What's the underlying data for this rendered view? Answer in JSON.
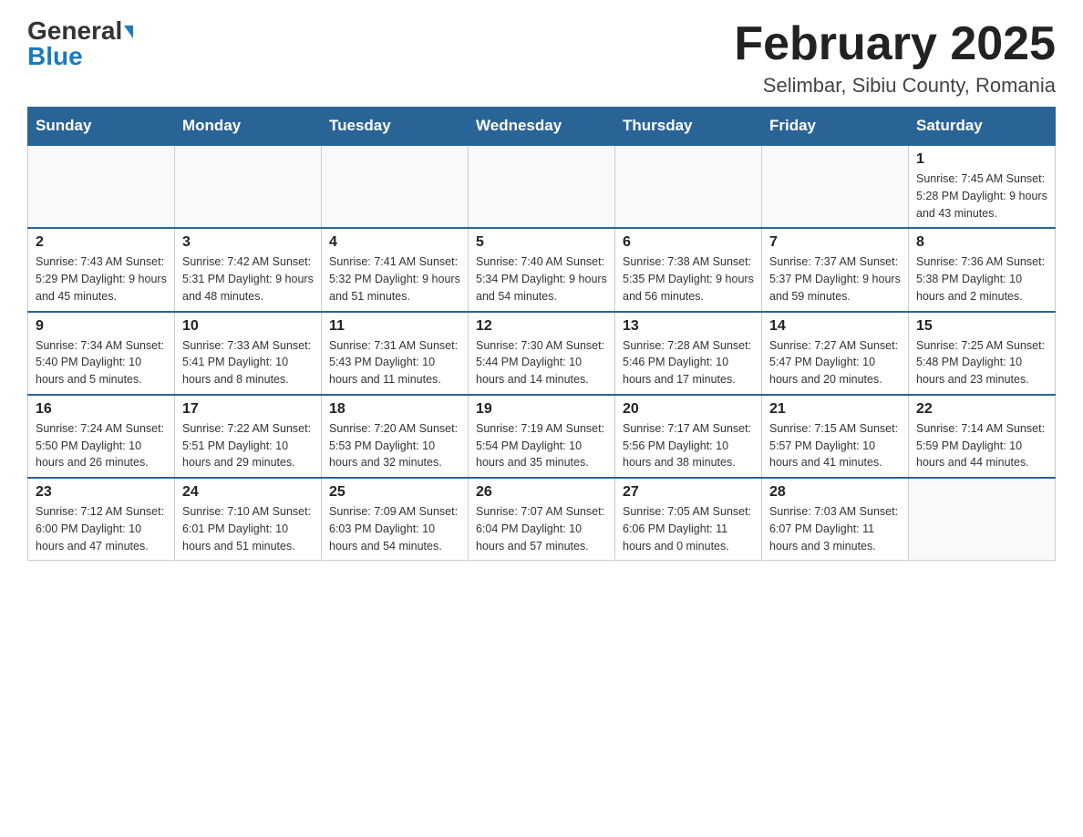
{
  "header": {
    "logo_general": "General",
    "logo_blue": "Blue",
    "month_title": "February 2025",
    "location": "Selimbar, Sibiu County, Romania"
  },
  "days_of_week": [
    "Sunday",
    "Monday",
    "Tuesday",
    "Wednesday",
    "Thursday",
    "Friday",
    "Saturday"
  ],
  "weeks": [
    [
      {
        "day": "",
        "info": ""
      },
      {
        "day": "",
        "info": ""
      },
      {
        "day": "",
        "info": ""
      },
      {
        "day": "",
        "info": ""
      },
      {
        "day": "",
        "info": ""
      },
      {
        "day": "",
        "info": ""
      },
      {
        "day": "1",
        "info": "Sunrise: 7:45 AM\nSunset: 5:28 PM\nDaylight: 9 hours and 43 minutes."
      }
    ],
    [
      {
        "day": "2",
        "info": "Sunrise: 7:43 AM\nSunset: 5:29 PM\nDaylight: 9 hours and 45 minutes."
      },
      {
        "day": "3",
        "info": "Sunrise: 7:42 AM\nSunset: 5:31 PM\nDaylight: 9 hours and 48 minutes."
      },
      {
        "day": "4",
        "info": "Sunrise: 7:41 AM\nSunset: 5:32 PM\nDaylight: 9 hours and 51 minutes."
      },
      {
        "day": "5",
        "info": "Sunrise: 7:40 AM\nSunset: 5:34 PM\nDaylight: 9 hours and 54 minutes."
      },
      {
        "day": "6",
        "info": "Sunrise: 7:38 AM\nSunset: 5:35 PM\nDaylight: 9 hours and 56 minutes."
      },
      {
        "day": "7",
        "info": "Sunrise: 7:37 AM\nSunset: 5:37 PM\nDaylight: 9 hours and 59 minutes."
      },
      {
        "day": "8",
        "info": "Sunrise: 7:36 AM\nSunset: 5:38 PM\nDaylight: 10 hours and 2 minutes."
      }
    ],
    [
      {
        "day": "9",
        "info": "Sunrise: 7:34 AM\nSunset: 5:40 PM\nDaylight: 10 hours and 5 minutes."
      },
      {
        "day": "10",
        "info": "Sunrise: 7:33 AM\nSunset: 5:41 PM\nDaylight: 10 hours and 8 minutes."
      },
      {
        "day": "11",
        "info": "Sunrise: 7:31 AM\nSunset: 5:43 PM\nDaylight: 10 hours and 11 minutes."
      },
      {
        "day": "12",
        "info": "Sunrise: 7:30 AM\nSunset: 5:44 PM\nDaylight: 10 hours and 14 minutes."
      },
      {
        "day": "13",
        "info": "Sunrise: 7:28 AM\nSunset: 5:46 PM\nDaylight: 10 hours and 17 minutes."
      },
      {
        "day": "14",
        "info": "Sunrise: 7:27 AM\nSunset: 5:47 PM\nDaylight: 10 hours and 20 minutes."
      },
      {
        "day": "15",
        "info": "Sunrise: 7:25 AM\nSunset: 5:48 PM\nDaylight: 10 hours and 23 minutes."
      }
    ],
    [
      {
        "day": "16",
        "info": "Sunrise: 7:24 AM\nSunset: 5:50 PM\nDaylight: 10 hours and 26 minutes."
      },
      {
        "day": "17",
        "info": "Sunrise: 7:22 AM\nSunset: 5:51 PM\nDaylight: 10 hours and 29 minutes."
      },
      {
        "day": "18",
        "info": "Sunrise: 7:20 AM\nSunset: 5:53 PM\nDaylight: 10 hours and 32 minutes."
      },
      {
        "day": "19",
        "info": "Sunrise: 7:19 AM\nSunset: 5:54 PM\nDaylight: 10 hours and 35 minutes."
      },
      {
        "day": "20",
        "info": "Sunrise: 7:17 AM\nSunset: 5:56 PM\nDaylight: 10 hours and 38 minutes."
      },
      {
        "day": "21",
        "info": "Sunrise: 7:15 AM\nSunset: 5:57 PM\nDaylight: 10 hours and 41 minutes."
      },
      {
        "day": "22",
        "info": "Sunrise: 7:14 AM\nSunset: 5:59 PM\nDaylight: 10 hours and 44 minutes."
      }
    ],
    [
      {
        "day": "23",
        "info": "Sunrise: 7:12 AM\nSunset: 6:00 PM\nDaylight: 10 hours and 47 minutes."
      },
      {
        "day": "24",
        "info": "Sunrise: 7:10 AM\nSunset: 6:01 PM\nDaylight: 10 hours and 51 minutes."
      },
      {
        "day": "25",
        "info": "Sunrise: 7:09 AM\nSunset: 6:03 PM\nDaylight: 10 hours and 54 minutes."
      },
      {
        "day": "26",
        "info": "Sunrise: 7:07 AM\nSunset: 6:04 PM\nDaylight: 10 hours and 57 minutes."
      },
      {
        "day": "27",
        "info": "Sunrise: 7:05 AM\nSunset: 6:06 PM\nDaylight: 11 hours and 0 minutes."
      },
      {
        "day": "28",
        "info": "Sunrise: 7:03 AM\nSunset: 6:07 PM\nDaylight: 11 hours and 3 minutes."
      },
      {
        "day": "",
        "info": ""
      }
    ]
  ]
}
